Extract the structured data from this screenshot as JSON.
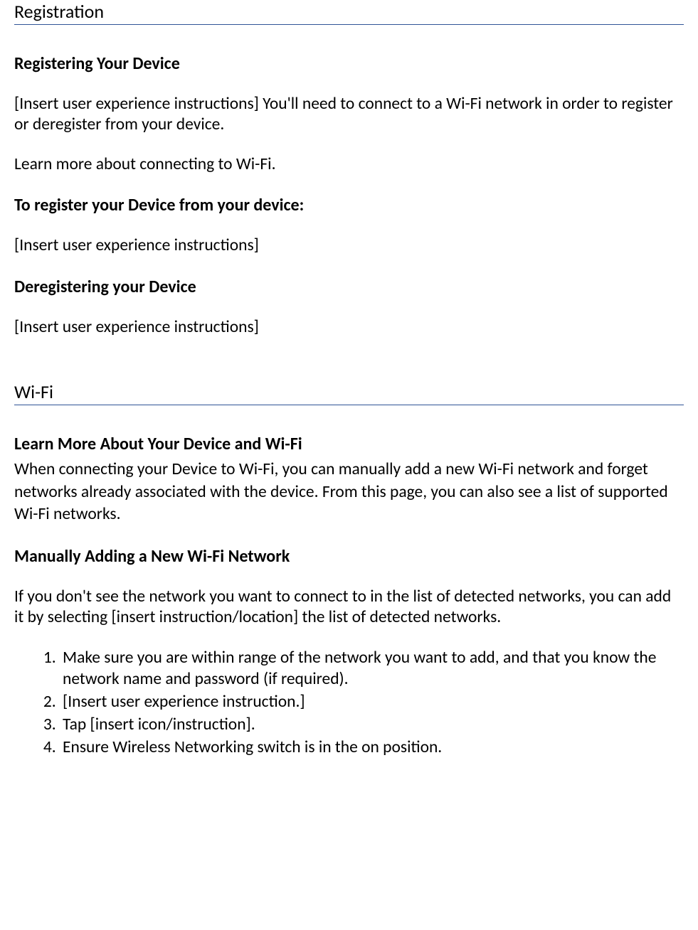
{
  "sections": {
    "registration": {
      "title": "Registration",
      "h_register_device": "Registering Your Device",
      "p_register_intro": "[Insert user experience instructions] You'll need to connect to a Wi-Fi network in order to register or deregister from your device.",
      "p_learn_more": "Learn more about connecting to Wi-Fi.",
      "h_to_register": "To register your Device  from your device:",
      "p_to_register_body": "[Insert user experience instructions]",
      "h_deregister": "Deregistering your Device",
      "p_deregister_body": "[Insert user experience instructions]"
    },
    "wifi": {
      "title": "Wi-Fi",
      "h_learn_more": "Learn More About Your Device and Wi-Fi",
      "p_learn_more_body": "When connecting your Device to Wi-Fi, you can manually add a new Wi-Fi network and forget networks already associated with the device. From this page, you can also see a list of supported Wi-Fi networks.",
      "h_manual_add": "Manually Adding a New Wi-Fi Network",
      "p_manual_add_body": "If you don't see the network you want to connect to in the list of detected networks, you can add it by selecting [insert instruction/location] the list of detected networks.",
      "steps": [
        "Make sure you are within range of the network you want to add, and that you know the network name and password (if required).",
        "[Insert user experience instruction.]",
        "Tap [insert icon/instruction].",
        "Ensure Wireless Networking switch is in the on position."
      ]
    }
  }
}
